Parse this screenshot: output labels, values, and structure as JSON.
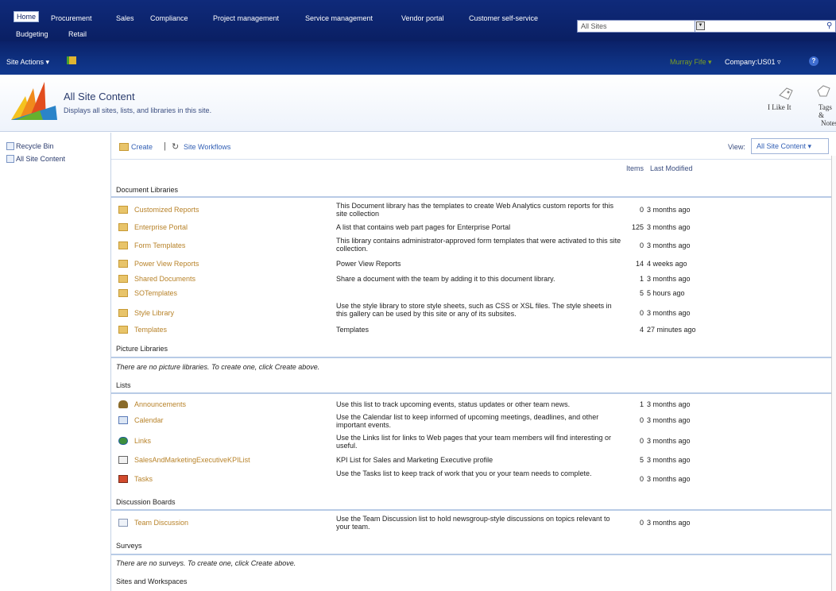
{
  "topnav": {
    "tabs": [
      "Home",
      "Procurement",
      "Sales",
      "Compliance",
      "Project management",
      "Service management",
      "Vendor portal",
      "Customer self-service",
      "Budgeting",
      "Retail"
    ],
    "search_scope": "All Sites",
    "search_placeholder": ""
  },
  "actionbar": {
    "site_actions": "Site Actions ▾",
    "user": "Murray Fife ▾",
    "company": "Company:US01 ▿"
  },
  "header": {
    "title": "All Site Content",
    "subtitle": "Displays all sites, lists, and libraries in this site.",
    "like_label": "I Like It",
    "tags_label_1": "Tags &",
    "tags_label_2": "Notes"
  },
  "leftnav": [
    "Recycle Bin",
    "All Site Content"
  ],
  "toolbar": {
    "create": "Create",
    "workflows": "Site Workflows",
    "view_label": "View:",
    "view_value": "All Site Content ▾"
  },
  "columns": {
    "items": "Items",
    "last_modified": "Last Modified"
  },
  "sections": {
    "doc_libs": {
      "title": "Document Libraries",
      "items": [
        {
          "name": "Customized Reports",
          "desc": "This Document library has the templates to create Web Analytics custom reports for this site collection",
          "count": "0",
          "modified": "3 months ago"
        },
        {
          "name": "Enterprise Portal",
          "desc": "A list that contains web part pages for Enterprise Portal",
          "count": "125",
          "modified": "3 months ago"
        },
        {
          "name": "Form Templates",
          "desc": "This library contains administrator-approved form templates that were activated to this site collection.",
          "count": "0",
          "modified": "3 months ago"
        },
        {
          "name": "Power View Reports",
          "desc": "Power View Reports",
          "count": "14",
          "modified": "4 weeks ago"
        },
        {
          "name": "Shared Documents",
          "desc": "Share a document with the team by adding it to this document library.",
          "count": "1",
          "modified": "3 months ago"
        },
        {
          "name": "SOTemplates",
          "desc": "",
          "count": "5",
          "modified": "5 hours ago"
        },
        {
          "name": "Style Library",
          "desc": "Use the style library to store style sheets, such as CSS or XSL files. The style sheets in this gallery can be used by this site or any of its subsites.",
          "count": "0",
          "modified": "3 months ago"
        },
        {
          "name": "Templates",
          "desc": "Templates",
          "count": "4",
          "modified": "27 minutes ago"
        }
      ]
    },
    "pic_libs": {
      "title": "Picture Libraries",
      "empty": "There are no picture libraries. To create one, click Create above."
    },
    "lists": {
      "title": "Lists",
      "items": [
        {
          "name": "Announcements",
          "desc": "Use this list to track upcoming events, status updates or other team news.",
          "count": "1",
          "modified": "3 months ago"
        },
        {
          "name": "Calendar",
          "desc": "Use the Calendar list to keep informed of upcoming meetings, deadlines, and other important events.",
          "count": "0",
          "modified": "3 months ago"
        },
        {
          "name": "Links",
          "desc": "Use the Links list for links to Web pages that your team members will find interesting or useful.",
          "count": "0",
          "modified": "3 months ago"
        },
        {
          "name": "SalesAndMarketingExecutiveKPIList",
          "desc": "KPI List for Sales and Marketing Executive profile",
          "count": "5",
          "modified": "3 months ago"
        },
        {
          "name": "Tasks",
          "desc": "Use the Tasks list to keep track of work that you or your team needs to complete.",
          "count": "0",
          "modified": "3 months ago"
        }
      ]
    },
    "discussions": {
      "title": "Discussion Boards",
      "items": [
        {
          "name": "Team Discussion",
          "desc": "Use the Team Discussion list to hold newsgroup-style discussions on topics relevant to your team.",
          "count": "0",
          "modified": "3 months ago"
        }
      ]
    },
    "surveys": {
      "title": "Surveys",
      "empty": "There are no surveys. To create one, click Create above."
    },
    "sites": {
      "title": "Sites and Workspaces"
    }
  }
}
